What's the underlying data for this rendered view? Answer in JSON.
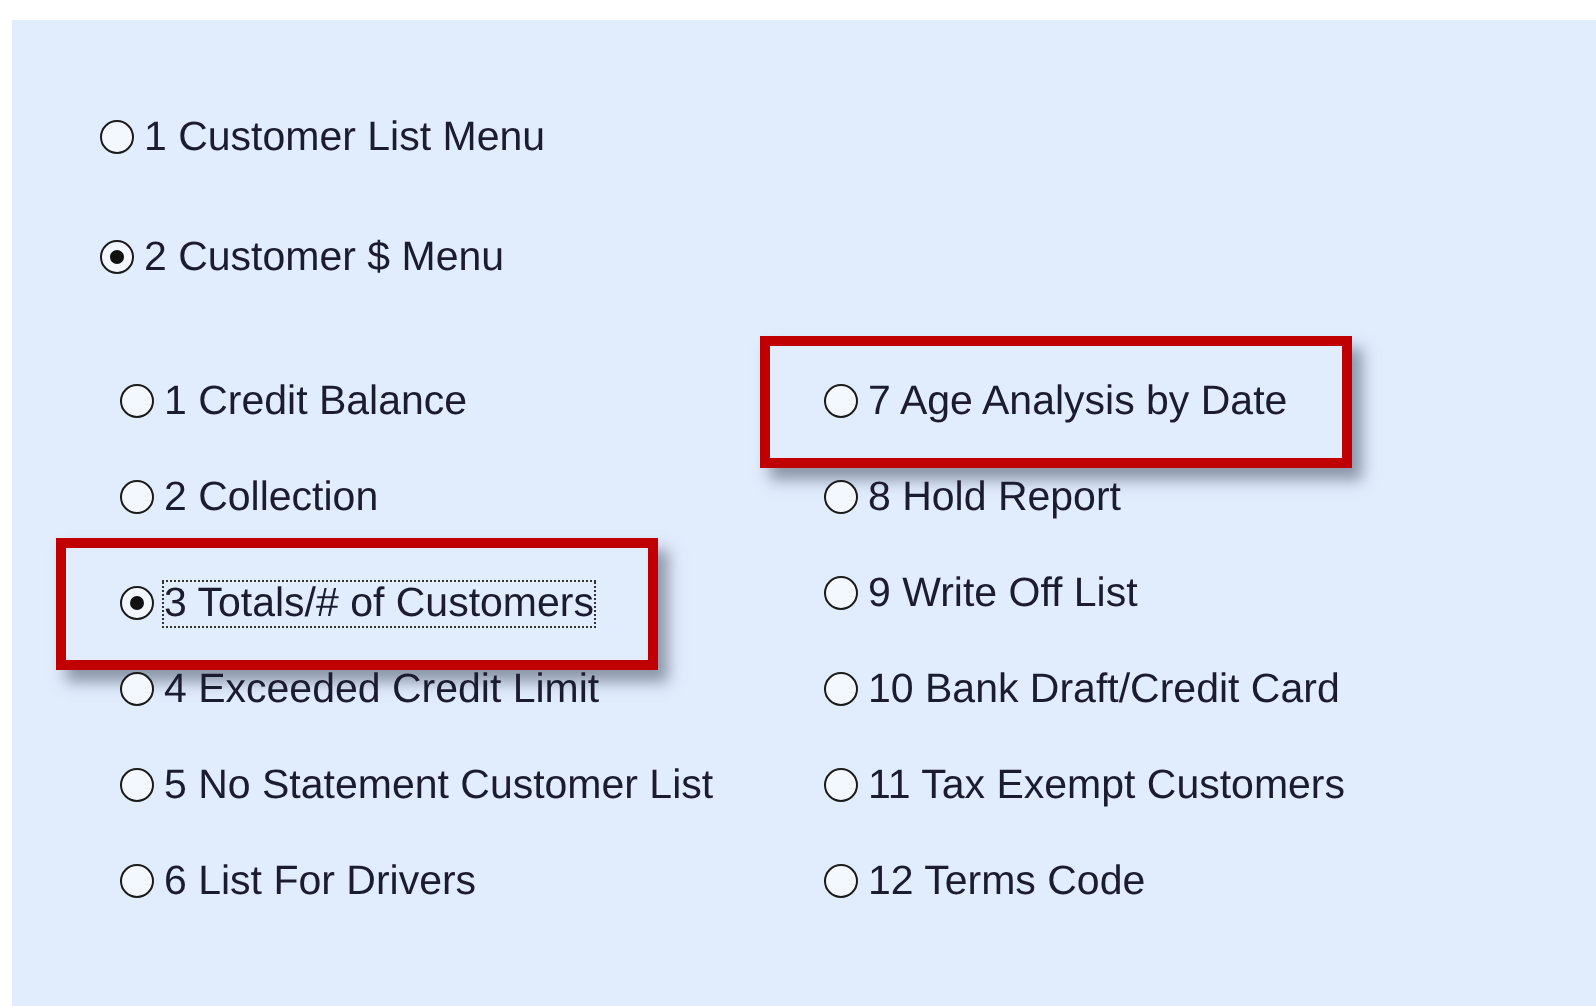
{
  "main_options": [
    {
      "label": "1 Customer List Menu",
      "selected": false
    },
    {
      "label": "2 Customer $ Menu",
      "selected": true
    }
  ],
  "sub_option_columns": [
    {
      "options": [
        {
          "label": "1 Credit Balance",
          "selected": false,
          "highlighted": false,
          "focused": false
        },
        {
          "label": "2 Collection",
          "selected": false,
          "highlighted": false,
          "focused": false
        },
        {
          "label": "3 Totals/# of Customers",
          "selected": true,
          "highlighted": true,
          "focused": true
        },
        {
          "label": "4 Exceeded Credit Limit",
          "selected": false,
          "highlighted": false,
          "focused": false
        },
        {
          "label": "5 No Statement Customer List",
          "selected": false,
          "highlighted": false,
          "focused": false
        },
        {
          "label": "6 List For Drivers",
          "selected": false,
          "highlighted": false,
          "focused": false
        }
      ]
    },
    {
      "options": [
        {
          "label": "7 Age Analysis by Date",
          "selected": false,
          "highlighted": true,
          "focused": false
        },
        {
          "label": "8 Hold Report",
          "selected": false,
          "highlighted": false,
          "focused": false
        },
        {
          "label": "9 Write Off List",
          "selected": false,
          "highlighted": false,
          "focused": false
        },
        {
          "label": "10 Bank Draft/Credit Card",
          "selected": false,
          "highlighted": false,
          "focused": false
        },
        {
          "label": "11 Tax Exempt Customers",
          "selected": false,
          "highlighted": false,
          "focused": false
        },
        {
          "label": "12 Terms Code",
          "selected": false,
          "highlighted": false,
          "focused": false
        }
      ]
    }
  ]
}
